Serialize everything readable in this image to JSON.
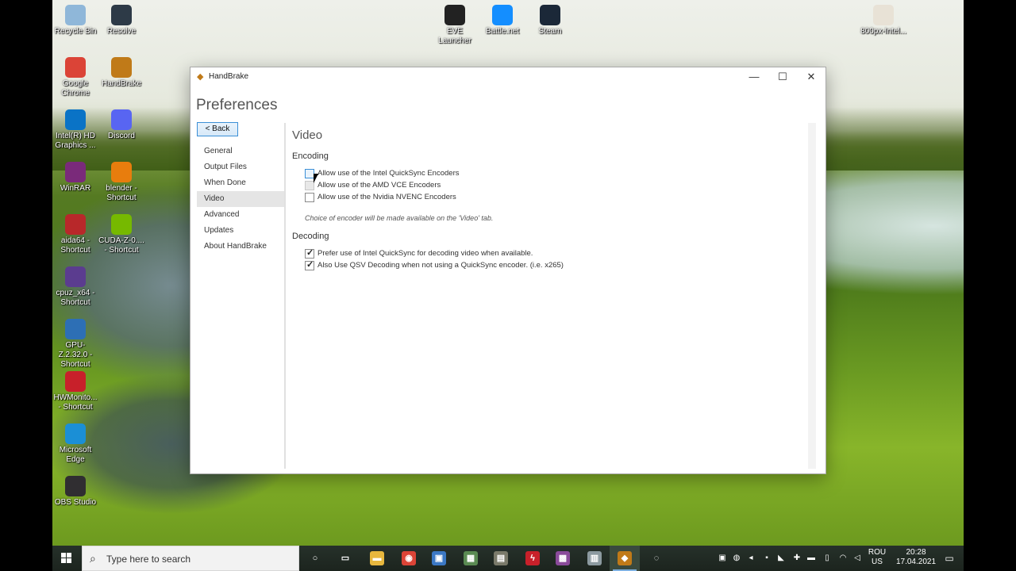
{
  "desktop_icons": [
    {
      "label": "Recycle Bin",
      "icon": "recycle-bin-icon",
      "color": "#8fb7d9"
    },
    {
      "label": "Resolve",
      "icon": "resolve-icon",
      "color": "#2d3a47"
    },
    {
      "label": "Google Chrome",
      "icon": "chrome-icon",
      "color": "#db4437"
    },
    {
      "label": "HandBrake",
      "icon": "handbrake-icon",
      "color": "#c07a18"
    },
    {
      "label": "Intel(R) HD Graphics ...",
      "icon": "intel-graphics-icon",
      "color": "#0a73c6"
    },
    {
      "label": "Discord",
      "icon": "discord-icon",
      "color": "#5865f2"
    },
    {
      "label": "WinRAR",
      "icon": "winrar-icon",
      "color": "#7a2a7a"
    },
    {
      "label": "blender - Shortcut",
      "icon": "blender-icon",
      "color": "#e87d0d"
    },
    {
      "label": "aida64 - Shortcut",
      "icon": "aida64-icon",
      "color": "#b8282a"
    },
    {
      "label": "CUDA-Z-0.... - Shortcut",
      "icon": "cuda-z-icon",
      "color": "#76b900"
    },
    {
      "label": "cpuz_x64 - Shortcut",
      "icon": "cpuz-icon",
      "color": "#5b3c8f"
    },
    {
      "label": "GPU-Z.2.32.0 - Shortcut",
      "icon": "gpu-z-icon",
      "color": "#2d6fb5"
    },
    {
      "label": "HWMonito... - Shortcut",
      "icon": "hwmonitor-icon",
      "color": "#c8202a"
    },
    {
      "label": "Microsoft Edge",
      "icon": "edge-icon",
      "color": "#1b8fd6"
    },
    {
      "label": "OBS Studio",
      "icon": "obs-icon",
      "color": "#302e31"
    },
    {
      "label": "EVE Launcher",
      "icon": "eve-icon",
      "color": "#222222"
    },
    {
      "label": "Battle.net",
      "icon": "battlenet-icon",
      "color": "#148eff"
    },
    {
      "label": "Steam",
      "icon": "steam-icon",
      "color": "#1b2838"
    },
    {
      "label": "800px-Intel...",
      "icon": "image-file-icon",
      "color": "#e8e2d6"
    }
  ],
  "window": {
    "title": "HandBrake",
    "minimize_glyph": "—",
    "maximize_glyph": "☐",
    "close_glyph": "✕"
  },
  "preferences": {
    "heading": "Preferences",
    "back_label": "< Back",
    "nav": [
      "General",
      "Output Files",
      "When Done",
      "Video",
      "Advanced",
      "Updates",
      "About HandBrake"
    ],
    "active_nav": "Video"
  },
  "video_section": {
    "title": "Video",
    "encoding_title": "Encoding",
    "encoders": [
      {
        "label": "Allow use of the Intel QuickSync Encoders",
        "checked": false,
        "state": "hover"
      },
      {
        "label": "Allow use of the AMD VCE Encoders",
        "checked": false,
        "state": "disabled"
      },
      {
        "label": "Allow use of the Nvidia NVENC Encoders",
        "checked": false,
        "state": "normal"
      }
    ],
    "encoder_note": "Choice of encoder will be made available on the 'Video' tab.",
    "decoding_title": "Decoding",
    "decoders": [
      {
        "label": "Prefer use of Intel QuickSync for decoding video when available.",
        "checked": true
      },
      {
        "label": "Also Use QSV Decoding when not using a QuickSync encoder. (i.e. x265)",
        "checked": true
      }
    ]
  },
  "taskbar": {
    "search_placeholder": "Type here to search",
    "apps": [
      {
        "name": "cortana-icon",
        "glyph": "○",
        "color": "transparent"
      },
      {
        "name": "task-view-icon",
        "glyph": "▭",
        "color": "transparent"
      },
      {
        "name": "file-explorer-icon",
        "glyph": "▬",
        "color": "#e7b73e"
      },
      {
        "name": "chrome-icon",
        "glyph": "◉",
        "color": "#db4437"
      },
      {
        "name": "app-icon",
        "glyph": "▣",
        "color": "#3b78c4"
      },
      {
        "name": "app-icon",
        "glyph": "▦",
        "color": "#5a8a52"
      },
      {
        "name": "app-icon",
        "glyph": "▤",
        "color": "#7a7a6a"
      },
      {
        "name": "app-icon",
        "glyph": "ϟ",
        "color": "#c8202a"
      },
      {
        "name": "app-icon",
        "glyph": "▩",
        "color": "#8a4a9a"
      },
      {
        "name": "app-icon",
        "glyph": "▥",
        "color": "#8c9aa0"
      },
      {
        "name": "handbrake-icon",
        "glyph": "◆",
        "color": "#c07a18"
      },
      {
        "name": "app-icon",
        "glyph": "◌",
        "color": "transparent"
      }
    ],
    "lang_line1": "ROU",
    "lang_line2": "US",
    "time": "20:28",
    "date": "17.04.2021"
  }
}
